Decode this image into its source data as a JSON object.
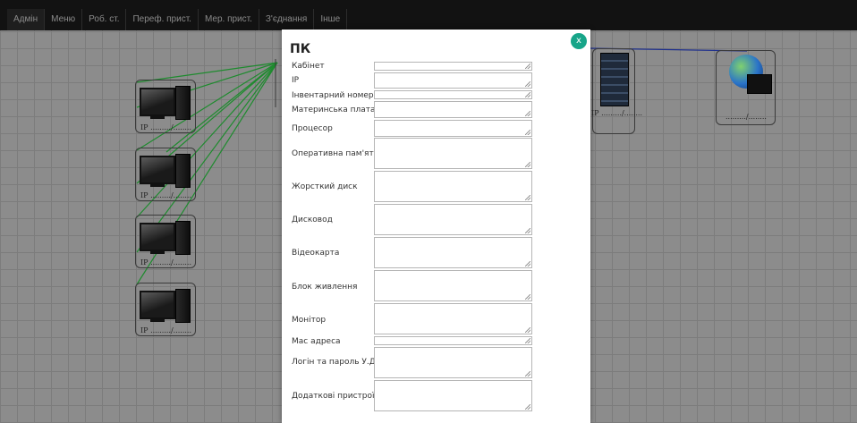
{
  "nav": {
    "items": [
      {
        "label": "Адмін"
      },
      {
        "label": "Меню"
      },
      {
        "label": "Роб. ст."
      },
      {
        "label": "Переф. прист."
      },
      {
        "label": "Мер. прист."
      },
      {
        "label": "З'єднання"
      },
      {
        "label": "Інше"
      }
    ]
  },
  "canvas": {
    "pc_labels": [
      "IP ........./........",
      "IP ........./........",
      "IP ........./........",
      "IP ........./........"
    ],
    "server_label": "IP ........./........",
    "internet_label": "........./........",
    "colors": {
      "pc_link": "#1e8b2e",
      "uplink": "#1e2f8c"
    }
  },
  "modal": {
    "title": "ПК",
    "close_label": "x",
    "accent": "#17a589",
    "fields": [
      {
        "label": "Кабінет",
        "value": ""
      },
      {
        "label": "IP",
        "value": ""
      },
      {
        "label": "Інвентарний номер",
        "value": ""
      },
      {
        "label": "Материнська плата",
        "value": ""
      },
      {
        "label": "Процесор",
        "value": ""
      },
      {
        "label": "Оперативна пам'ять",
        "value": ""
      },
      {
        "label": "Жорсткий диск",
        "value": ""
      },
      {
        "label": "Дисковод",
        "value": ""
      },
      {
        "label": "Відеокарта",
        "value": ""
      },
      {
        "label": "Блок живлення",
        "value": ""
      },
      {
        "label": "Монітор",
        "value": ""
      },
      {
        "label": "Мас адреса",
        "value": ""
      },
      {
        "label": "Логін та пароль У.Д.",
        "value": ""
      },
      {
        "label": "Додаткові пристрої",
        "value": ""
      }
    ]
  }
}
